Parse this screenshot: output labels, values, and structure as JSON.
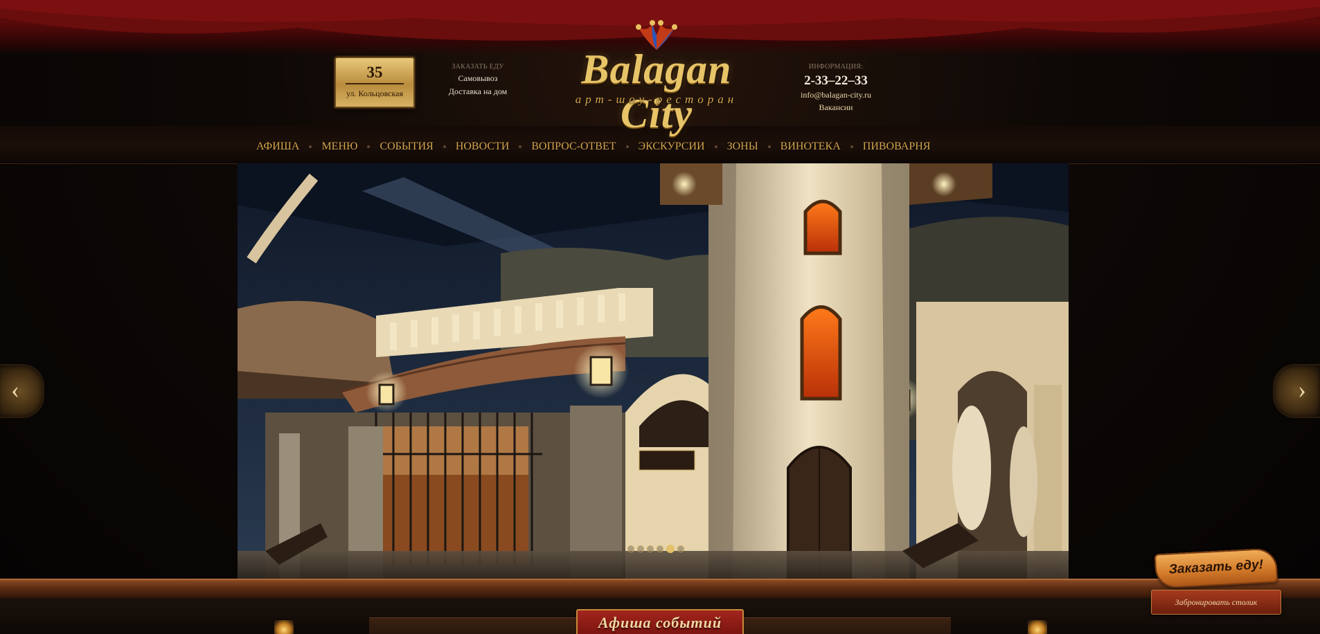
{
  "header": {
    "address": {
      "number": "35",
      "street": "ул. Кольцовская"
    },
    "order_food": {
      "caption": "ЗАКАЗАТЬ ЕДУ",
      "pickup": "Самовывоз",
      "delivery": "Доставка на дом"
    },
    "logo": {
      "title": "Balagan City",
      "subtitle": "арт-шоу-ресторан"
    },
    "info": {
      "caption": "ИНФОРМАЦИЯ:",
      "phone": "2-33–22–33",
      "email": "info@balagan-city.ru",
      "vacancies": "Вакансии"
    }
  },
  "nav": {
    "items": [
      {
        "label": "АФИША"
      },
      {
        "label": "МЕНЮ"
      },
      {
        "label": "СОБЫТИЯ"
      },
      {
        "label": "НОВОСТИ"
      },
      {
        "label": "ВОПРОС-ОТВЕТ"
      },
      {
        "label": "ЭКСКУРСИИ"
      },
      {
        "label": "ЗОНЫ"
      },
      {
        "label": "ВИНОТЕКА"
      },
      {
        "label": "ПИВОВАРНЯ"
      }
    ]
  },
  "slider": {
    "slide_count": 6,
    "active_index": 4,
    "prev_glyph": "‹",
    "next_glyph": "›"
  },
  "bottom": {
    "afisha_tab": "Афиша событий"
  },
  "order_widget": {
    "order_label": "Заказать еду!",
    "reserve_label": "Забронировать столик"
  },
  "colors": {
    "nav_text": "#d4a64d",
    "logo_gold": "#e7c468",
    "accent_red": "#7a1410"
  }
}
